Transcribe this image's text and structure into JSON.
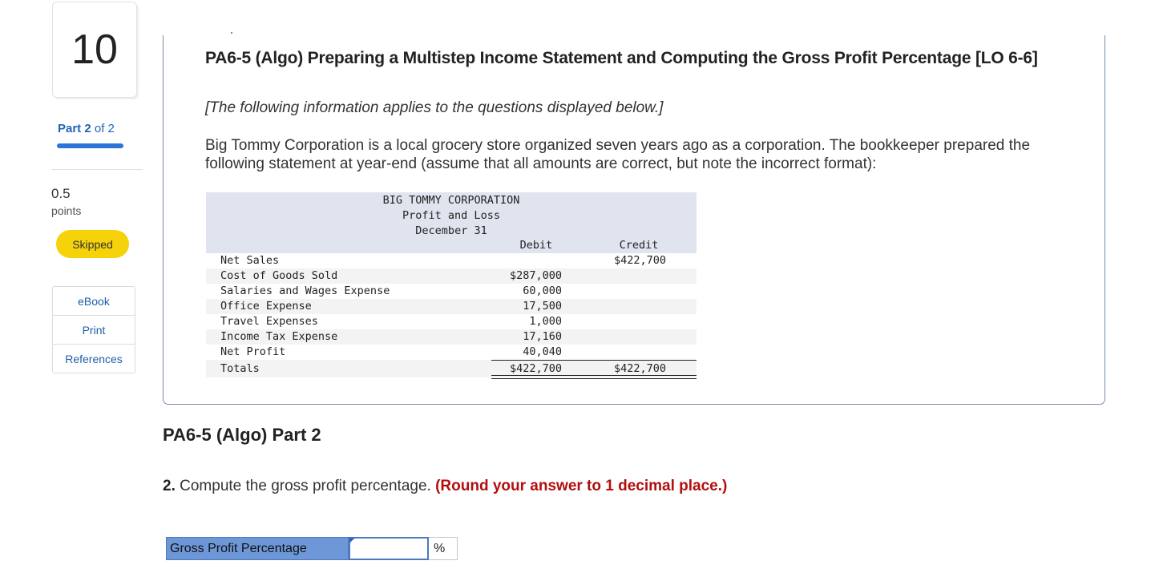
{
  "sidebar": {
    "question_number": "10",
    "part_prefix": "Part",
    "part_current": "2",
    "part_of": "of 2",
    "progress_fraction": 1.0,
    "points_value": "0.5",
    "points_label": "points",
    "status_badge": "Skipped",
    "resources": [
      "eBook",
      "Print",
      "References"
    ]
  },
  "question": {
    "title": "PA6-5 (Algo) Preparing a Multistep Income Statement and Computing the Gross Profit Percentage [LO 6-6]",
    "info_note": "[The following information applies to the questions displayed below.]",
    "body": "Big Tommy Corporation is a local grocery store organized seven years ago as a corporation. The bookkeeper prepared the following statement at year-end (assume that all amounts are correct, but note the incorrect format):"
  },
  "statement": {
    "company": "BIG TOMMY CORPORATION",
    "title": "Profit and Loss",
    "date": "December 31",
    "col_debit": "Debit",
    "col_credit": "Credit",
    "rows": [
      {
        "label": "Net Sales",
        "debit": "",
        "credit": "$422,700"
      },
      {
        "label": "Cost of Goods Sold",
        "debit": "$287,000",
        "credit": ""
      },
      {
        "label": "Salaries and Wages Expense",
        "debit": "60,000",
        "credit": ""
      },
      {
        "label": "Office Expense",
        "debit": "17,500",
        "credit": ""
      },
      {
        "label": "Travel Expenses",
        "debit": "1,000",
        "credit": ""
      },
      {
        "label": "Income Tax Expense",
        "debit": "17,160",
        "credit": ""
      },
      {
        "label": "Net Profit",
        "debit": "40,040",
        "credit": ""
      },
      {
        "label": "Totals",
        "debit": "$422,700",
        "credit": "$422,700"
      }
    ]
  },
  "part2": {
    "title": "PA6-5 (Algo) Part 2",
    "question_number": "2.",
    "question_text": " Compute the gross profit percentage. ",
    "hint": "(Round your answer to 1 decimal place.)",
    "answer_label": "Gross Profit Percentage",
    "answer_value": "",
    "unit": "%"
  }
}
